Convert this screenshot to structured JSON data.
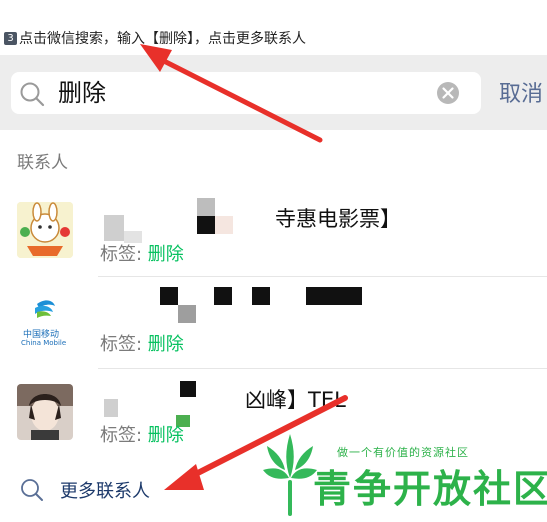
{
  "instruction": {
    "step": "3",
    "text": "点击微信搜索，输入【删除】，点击更多联系人"
  },
  "search": {
    "query": "删除",
    "cancel_label": "取消"
  },
  "section_title": "联系人",
  "contacts": [
    {
      "title": "寺惠电影票】",
      "tag_label": "标签: ",
      "tag_value": "删除"
    },
    {
      "title": "",
      "tag_label": "标签: ",
      "tag_value": "删除",
      "avatar_text_1": "中国移动",
      "avatar_text_2": "China Mobile"
    },
    {
      "title": "凶峰】TEL",
      "tag_label": "标签: ",
      "tag_value": "删除"
    }
  ],
  "more_contacts_label": "更多联系人",
  "watermark": {
    "slogan": "做一个有价值的资源社区",
    "brand": "青争开放社区"
  },
  "colors": {
    "accent_green": "#07c160",
    "link_blue": "#586c94",
    "arrow_red": "#e8302a",
    "watermark_green": "#2db24a"
  }
}
